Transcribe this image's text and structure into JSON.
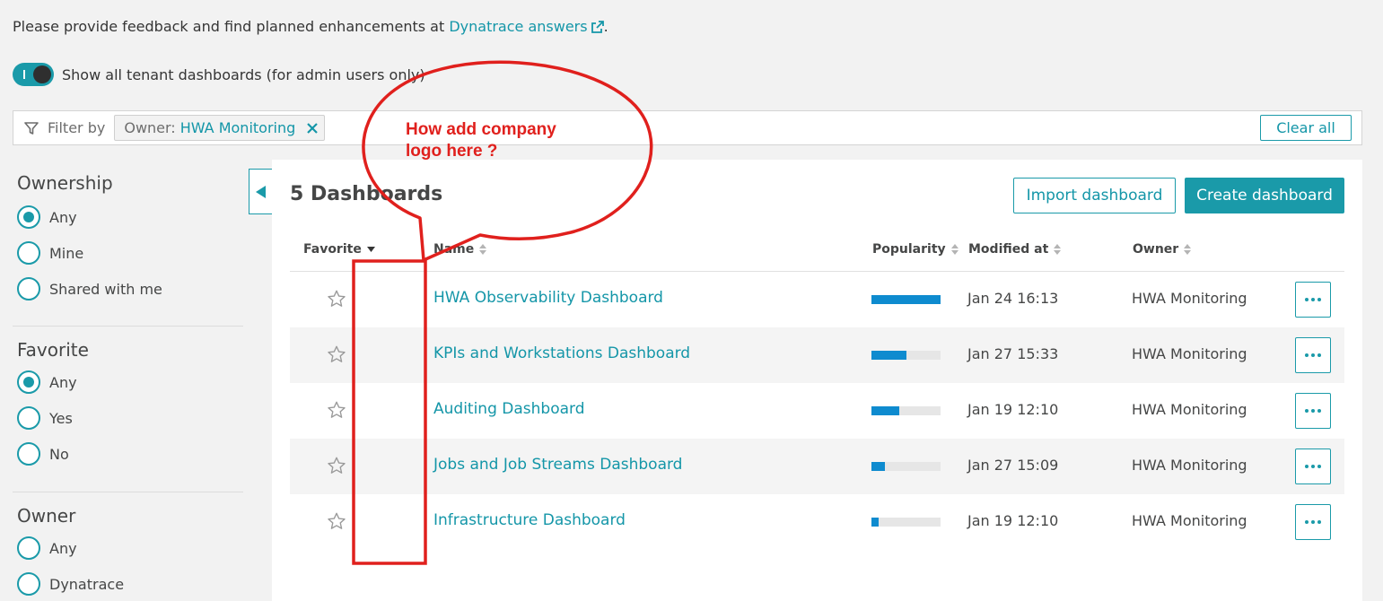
{
  "notice": {
    "text": "Please provide feedback and find planned enhancements at ",
    "link": "Dynatrace answers",
    "suffix": "."
  },
  "toggle": {
    "label": "Show all tenant dashboards (for admin users only)",
    "on": true
  },
  "filter": {
    "label": "Filter by",
    "chip_key": "Owner:",
    "chip_value": "HWA Monitoring",
    "clear_all": "Clear all"
  },
  "sidebar": {
    "sections": [
      {
        "title": "Ownership",
        "options": [
          {
            "label": "Any",
            "checked": true
          },
          {
            "label": "Mine",
            "checked": false
          },
          {
            "label": "Shared with me",
            "checked": false
          }
        ]
      },
      {
        "title": "Favorite",
        "options": [
          {
            "label": "Any",
            "checked": true
          },
          {
            "label": "Yes",
            "checked": false
          },
          {
            "label": "No",
            "checked": false
          }
        ]
      },
      {
        "title": "Owner",
        "options": [
          {
            "label": "Any",
            "checked": false
          },
          {
            "label": "Dynatrace",
            "checked": false
          }
        ]
      }
    ]
  },
  "panel": {
    "title": "5 Dashboards",
    "import_button": "Import dashboard",
    "create_button": "Create dashboard"
  },
  "table": {
    "headers": {
      "favorite": "Favorite",
      "name": "Name",
      "popularity": "Popularity",
      "modified": "Modified at",
      "owner": "Owner"
    },
    "rows": [
      {
        "name": "HWA Observability Dashboard",
        "popularity": 1.0,
        "modified": "Jan 24 16:13",
        "owner": "HWA Monitoring"
      },
      {
        "name": "KPIs and Workstations Dashboard",
        "popularity": 0.5,
        "modified": "Jan 27 15:33",
        "owner": "HWA Monitoring"
      },
      {
        "name": "Auditing Dashboard",
        "popularity": 0.4,
        "modified": "Jan 19 12:10",
        "owner": "HWA Monitoring"
      },
      {
        "name": "Jobs and Job Streams Dashboard",
        "popularity": 0.2,
        "modified": "Jan 27 15:09",
        "owner": "HWA Monitoring"
      },
      {
        "name": "Infrastructure Dashboard",
        "popularity": 0.1,
        "modified": "Jan 19 12:10",
        "owner": "HWA Monitoring"
      }
    ]
  },
  "annotation": {
    "text": "How add company\nlogo here ?",
    "color": "#e0201d"
  },
  "colors": {
    "accent": "#1a9aa9",
    "link": "#1496a8",
    "popularity_bar": "#0e8bcf"
  }
}
